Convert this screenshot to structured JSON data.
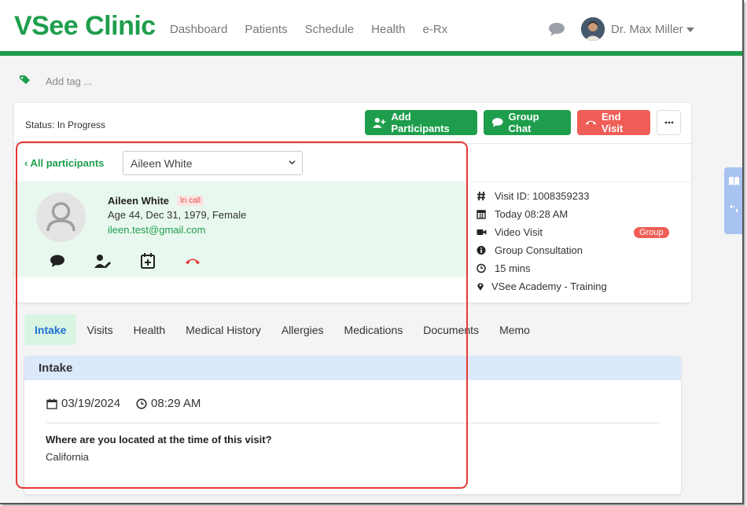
{
  "navbar": {
    "logo": "VSee Clinic",
    "links": [
      "Dashboard",
      "Patients",
      "Schedule",
      "Health",
      "e-Rx"
    ],
    "user_name": "Dr. Max Miller"
  },
  "tag": {
    "placeholder": "Add tag ..."
  },
  "visit_card": {
    "status": "Status: In Progress",
    "buttons": {
      "add_participants": "Add Participants",
      "group_chat": "Group Chat",
      "end_visit": "End Visit"
    },
    "back_link": "All participants",
    "participant_select": "Aileen White"
  },
  "patient": {
    "name": "Aileen White",
    "badge": "In call",
    "details": "Age 44, Dec 31, 1979, Female",
    "email": "ileen.test@gmail.com"
  },
  "visit_info": {
    "visit_id": "Visit ID: 1008359233",
    "date": "Today 08:28 AM",
    "type": "Video Visit",
    "type_badge": "Group",
    "consultation": "Group Consultation",
    "duration": "15 mins",
    "location": "VSee Academy - Training"
  },
  "tabs": [
    {
      "label": "Intake",
      "active": true
    },
    {
      "label": "Visits",
      "active": false
    },
    {
      "label": "Health",
      "active": false
    },
    {
      "label": "Medical History",
      "active": false
    },
    {
      "label": "Allergies",
      "active": false
    },
    {
      "label": "Medications",
      "active": false
    },
    {
      "label": "Documents",
      "active": false
    },
    {
      "label": "Memo",
      "active": false
    }
  ],
  "intake": {
    "title": "Intake",
    "date": "03/19/2024",
    "time": "08:29 AM",
    "question": "Where are you located at the time of this visit?",
    "answer": "California"
  },
  "colors": {
    "brand_green": "#1e9e4c",
    "danger_red": "#ef5d57",
    "highlight_red": "#e53935",
    "active_tab_text": "#1e6fd1"
  },
  "icons": [
    "comment-icon",
    "tag-icon",
    "user-plus-icon",
    "phone-hangup-icon",
    "ellipsis-icon",
    "chevron-left-icon",
    "chevron-down-icon",
    "hash-icon",
    "calendar-icon",
    "video-icon",
    "info-icon",
    "clock-icon",
    "map-marker-icon",
    "user-edit-icon",
    "calendar-plus-icon"
  ]
}
